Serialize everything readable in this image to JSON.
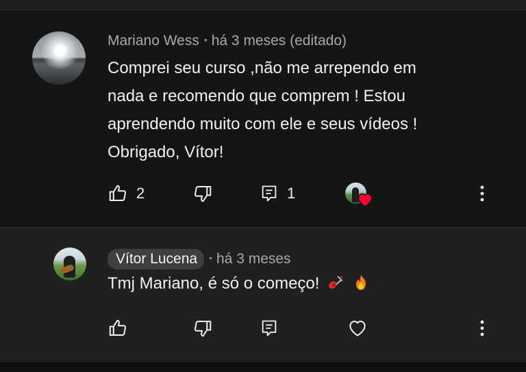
{
  "comment": {
    "author": "Mariano Wess",
    "time": "há 3 meses (editado)",
    "text_lines": [
      "Comprei seu curso ,não me arrependo em",
      "nada e recomendo que comprem  !  Estou",
      "aprendendo muito com ele e seus vídeos !",
      "Obrigado, Vítor!"
    ],
    "like_count": "2",
    "reply_count": "1",
    "hearted": true
  },
  "reply": {
    "author": "Vítor Lucena",
    "time": "há 3 meses",
    "text": "Tmj Mariano, é só o começo!",
    "emojis": [
      "guitar-emoji",
      "fire-emoji"
    ]
  },
  "icons": {
    "like": "thumbs-up-icon",
    "dislike": "thumbs-down-icon",
    "reply": "comment-reply-icon",
    "heart": "heart-outline-icon",
    "more": "more-vertical-icon"
  },
  "colors": {
    "background": "#121212",
    "reply_background": "#202020",
    "text": "#f1f1f1",
    "meta": "#aaaaaa",
    "heart_red": "#ff0033"
  }
}
